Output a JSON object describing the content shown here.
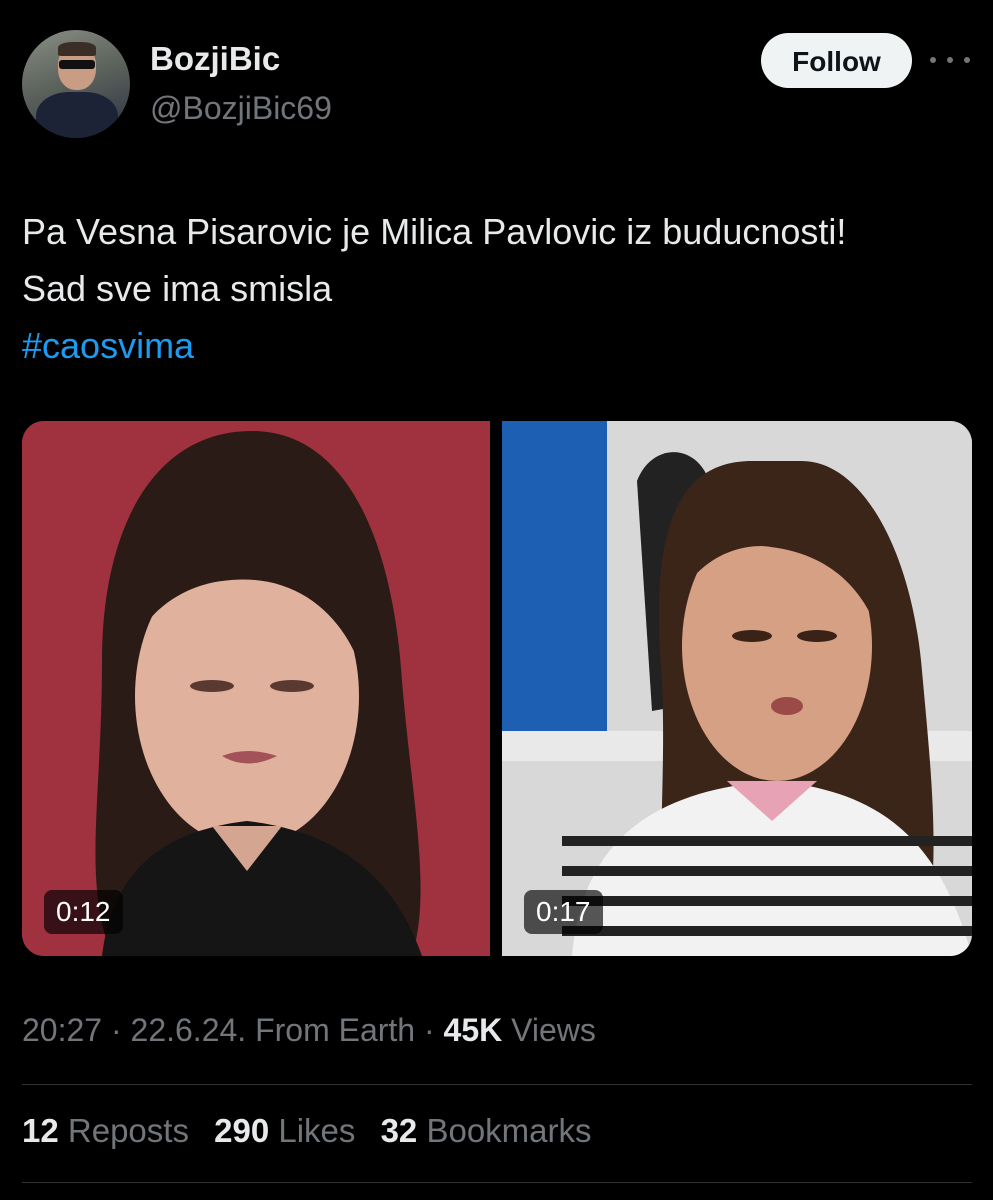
{
  "user": {
    "display_name": "BozjiBic",
    "handle": "@BozjiBic69",
    "avatar_icon": "profile-photo"
  },
  "actions": {
    "follow_label": "Follow",
    "more_icon": "more-horizontal-icon"
  },
  "tweet": {
    "line1": "Pa Vesna Pisarovic je Milica Pavlovic iz buducnosti!",
    "line2": "Sad sve ima smisla",
    "hashtag": "#caosvima"
  },
  "media": {
    "video1_duration": "0:12",
    "video2_duration": "0:17"
  },
  "meta": {
    "time": "20:27",
    "sep1": "·",
    "date": "22.6.24.",
    "source": "From Earth",
    "sep2": "·",
    "views_count": "45K",
    "views_label": "Views"
  },
  "stats": {
    "reposts_count": "12",
    "reposts_label": "Reposts",
    "likes_count": "290",
    "likes_label": "Likes",
    "bookmarks_count": "32",
    "bookmarks_label": "Bookmarks"
  },
  "colors": {
    "background": "#000000",
    "text": "#e7e9ea",
    "secondary_text": "#71767b",
    "link": "#1d9bf0",
    "follow_button": "#eff3f4"
  }
}
